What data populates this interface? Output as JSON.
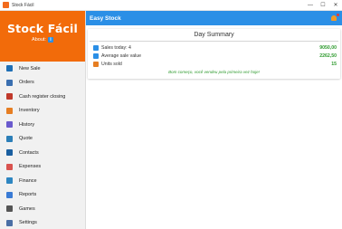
{
  "window": {
    "title": "Stock Fácil",
    "controls": {
      "minimize": "—",
      "maximize": "☐",
      "close": "✕"
    }
  },
  "sidebar": {
    "brand": "Stock Fácil",
    "about_label": "About:",
    "about_icon": "i",
    "items": [
      {
        "label": "New Sale",
        "icon": "cart-icon",
        "color": "#1f6fb5"
      },
      {
        "label": "Orders",
        "icon": "orders-icon",
        "color": "#3a6fb0"
      },
      {
        "label": "Cash register closing",
        "icon": "cash-register-icon",
        "color": "#c0392b"
      },
      {
        "label": "Inventory",
        "icon": "inventory-icon",
        "color": "#e67e22"
      },
      {
        "label": "History",
        "icon": "hourglass-icon",
        "color": "#6a5acd"
      },
      {
        "label": "Quote",
        "icon": "quote-icon",
        "color": "#2c7fb8"
      },
      {
        "label": "Contacts",
        "icon": "contacts-icon",
        "color": "#1a5fa0"
      },
      {
        "label": "Expenses",
        "icon": "expenses-icon",
        "color": "#d9534f"
      },
      {
        "label": "Finance",
        "icon": "finance-icon",
        "color": "#2e86c1"
      },
      {
        "label": "Reports",
        "icon": "reports-icon",
        "color": "#3a7bd5"
      },
      {
        "label": "Games",
        "icon": "gamepad-icon",
        "color": "#555555"
      },
      {
        "label": "Settings",
        "icon": "gear-icon",
        "color": "#4a6fa5"
      }
    ]
  },
  "header": {
    "title": "Easy Stock",
    "notification_icon": "bell-icon"
  },
  "summary": {
    "title": "Day Summary",
    "rows": [
      {
        "label": "Sales today:  4",
        "value": "9050,00",
        "icon": "sales-icon",
        "color": "#2b8fe6"
      },
      {
        "label": "Average sale value",
        "value": "2262,50",
        "icon": "average-icon",
        "color": "#2b8fe6"
      },
      {
        "label": "Units sold",
        "value": "15",
        "icon": "units-icon",
        "color": "#e67e22"
      }
    ],
    "message": "Bom começo, você vendeu pela primeira vez hoje!"
  },
  "colors": {
    "accent": "#2b8fe6",
    "brand": "#f26b0a",
    "positive": "#2e9a2e"
  }
}
